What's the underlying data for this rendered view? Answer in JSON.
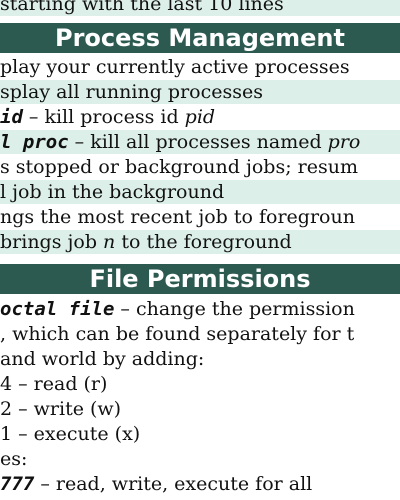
{
  "top_fragment": "starting with the last 10 lines",
  "process_section": {
    "title": "Process Management",
    "lines": [
      {
        "text": "play your currently active processes"
      },
      {
        "text": "splay all running processes"
      },
      {
        "cmd": "id",
        "text": " – kill process id ",
        "arg": "pid"
      },
      {
        "cmd": "l proc",
        "text": " – kill all processes named ",
        "arg": "pro"
      },
      {
        "text": "s stopped or background jobs; resum"
      },
      {
        "text": "l job in the background"
      },
      {
        "text": "ngs the most recent job to foregroun"
      },
      {
        "pre": "brings job ",
        "arg": "n",
        "text": " to the foreground"
      }
    ]
  },
  "permissions_section": {
    "title": "File Permissions",
    "lines": [
      {
        "cmd": "octal file",
        "text": " – change the permission"
      },
      {
        "text": ", which can be found separately for t"
      },
      {
        "text": "and world by adding:"
      },
      {
        "text": "4 – read (r)"
      },
      {
        "text": "2 – write (w)"
      },
      {
        "text": "1 – execute (x)"
      },
      {
        "text": "es:"
      },
      {
        "cmd": "777",
        "text": " – read, write, execute for all"
      }
    ]
  }
}
